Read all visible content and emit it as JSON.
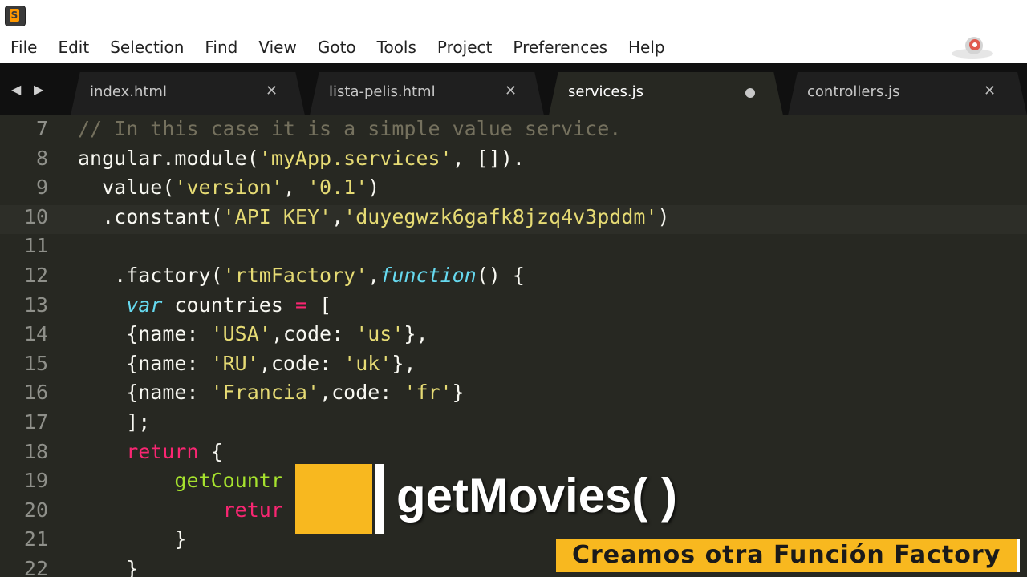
{
  "menu": [
    "File",
    "Edit",
    "Selection",
    "Find",
    "View",
    "Goto",
    "Tools",
    "Project",
    "Preferences",
    "Help"
  ],
  "tabs": [
    {
      "label": "index.html",
      "state": "close"
    },
    {
      "label": "lista-pelis.html",
      "state": "close"
    },
    {
      "label": "services.js",
      "state": "dirty",
      "active": true
    },
    {
      "label": "controllers.js",
      "state": "close"
    }
  ],
  "editor": {
    "lines": [
      {
        "num": "7",
        "tokens": [
          [
            "c",
            "// In this case it is a simple value service."
          ]
        ]
      },
      {
        "num": "8",
        "tokens": [
          [
            "",
            "angular.module("
          ],
          [
            "s",
            "'myApp.services'"
          ],
          [
            "",
            ", [])."
          ]
        ]
      },
      {
        "num": "9",
        "tokens": [
          [
            "",
            "  value("
          ],
          [
            "s",
            "'version'"
          ],
          [
            "",
            ", "
          ],
          [
            "s",
            "'0.1'"
          ],
          [
            "",
            ")"
          ]
        ]
      },
      {
        "num": "10",
        "current": true,
        "tokens": [
          [
            "",
            "  .constant("
          ],
          [
            "s",
            "'API_KEY'"
          ],
          [
            "",
            ","
          ],
          [
            "s",
            "'duyegwzk6gafk8jzq4v3pddm'"
          ],
          [
            "",
            ")"
          ]
        ]
      },
      {
        "num": "11",
        "tokens": []
      },
      {
        "num": "12",
        "tokens": [
          [
            "",
            "   .factory("
          ],
          [
            "s",
            "'rtmFactory'"
          ],
          [
            "",
            ","
          ],
          [
            "st",
            "function"
          ],
          [
            "",
            "() {"
          ]
        ]
      },
      {
        "num": "13",
        "tokens": [
          [
            "",
            "    "
          ],
          [
            "st",
            "var"
          ],
          [
            "",
            " countries "
          ],
          [
            "k",
            "="
          ],
          [
            "",
            " ["
          ]
        ]
      },
      {
        "num": "14",
        "tokens": [
          [
            "",
            "    {name: "
          ],
          [
            "s",
            "'USA'"
          ],
          [
            "",
            ",code: "
          ],
          [
            "s",
            "'us'"
          ],
          [
            "",
            "},"
          ]
        ]
      },
      {
        "num": "15",
        "tokens": [
          [
            "",
            "    {name: "
          ],
          [
            "s",
            "'RU'"
          ],
          [
            "",
            ",code: "
          ],
          [
            "s",
            "'uk'"
          ],
          [
            "",
            "},"
          ]
        ]
      },
      {
        "num": "16",
        "tokens": [
          [
            "",
            "    {name: "
          ],
          [
            "s",
            "'Francia'"
          ],
          [
            "",
            ",code: "
          ],
          [
            "s",
            "'fr'"
          ],
          [
            "",
            "}"
          ]
        ]
      },
      {
        "num": "17",
        "tokens": [
          [
            "",
            "    ];"
          ]
        ]
      },
      {
        "num": "18",
        "tokens": [
          [
            "",
            "    "
          ],
          [
            "k",
            "return"
          ],
          [
            "",
            " {"
          ]
        ]
      },
      {
        "num": "19",
        "tokens": [
          [
            "",
            "        "
          ],
          [
            "fn",
            "getCountr"
          ]
        ]
      },
      {
        "num": "20",
        "tokens": [
          [
            "",
            "            "
          ],
          [
            "k",
            "retur"
          ]
        ]
      },
      {
        "num": "21",
        "tokens": [
          [
            "",
            "        }"
          ]
        ]
      },
      {
        "num": "22",
        "tokens": [
          [
            "",
            "    }"
          ]
        ]
      }
    ]
  },
  "overlay": {
    "title": "getMovies( )",
    "caption": "Creamos otra Función Factory"
  },
  "colors": {
    "accent": "#f8b81f",
    "editor_bg": "#272822",
    "string": "#e6db74",
    "keyword": "#f92672",
    "storage": "#66d9ef",
    "comment": "#75715e"
  },
  "icons": {
    "app": "sublime-text-icon",
    "watermark": "logo-icon",
    "nav_left": "arrow-left-icon",
    "nav_right": "arrow-right-icon",
    "tab_close": "close-icon",
    "tab_dirty": "unsaved-dot-icon"
  }
}
